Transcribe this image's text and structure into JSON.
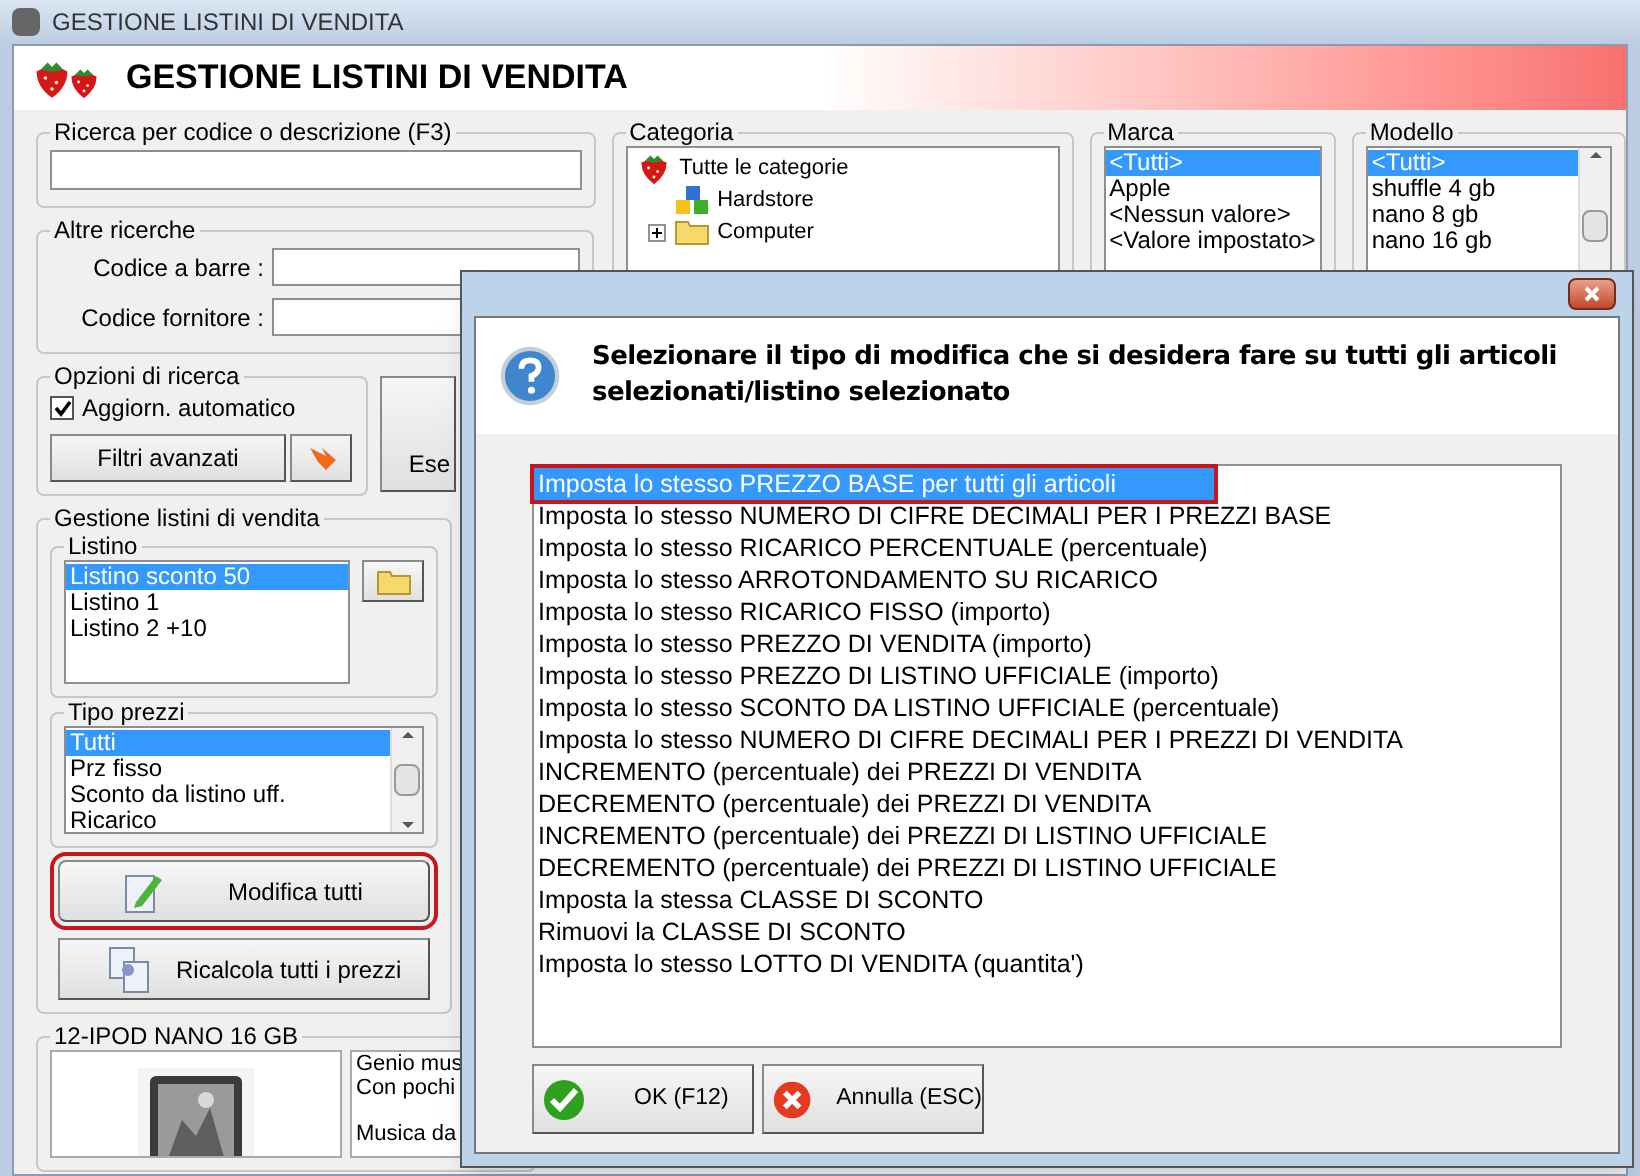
{
  "window": {
    "title": "GESTIONE LISTINI DI VENDITA"
  },
  "header": {
    "title": "GESTIONE LISTINI DI VENDITA"
  },
  "search": {
    "label": "Ricerca per codice o descrizione (F3)"
  },
  "other_searches": {
    "label": "Altre ricerche",
    "fields": [
      {
        "label": "Codice a barre :"
      },
      {
        "label": "Codice fornitore :"
      }
    ]
  },
  "search_options": {
    "label": "Opzioni di ricerca",
    "auto_update": {
      "label": "Aggiorn. automatico",
      "checked": true
    },
    "filters_button": "Filtri avanzati"
  },
  "execute_button": "Ese",
  "price_lists": {
    "label": "Gestione listini di vendita",
    "listino": {
      "label": "Listino",
      "items": [
        {
          "label": "Listino sconto 50",
          "selected": true
        },
        {
          "label": "Listino 1",
          "selected": false
        },
        {
          "label": "Listino 2 +10",
          "selected": false
        }
      ]
    },
    "price_types": {
      "label": "Tipo prezzi",
      "items": [
        {
          "label": "Tutti",
          "selected": true
        },
        {
          "label": "Prz fisso",
          "selected": false
        },
        {
          "label": "Sconto da listino uff.",
          "selected": false
        },
        {
          "label": "Ricarico",
          "selected": false
        }
      ]
    },
    "edit_all_button": {
      "label": "Modifica tutti",
      "highlighted": true
    },
    "recalc_button": {
      "label": "Ricalcola tutti i prezzi",
      "highlighted": false
    }
  },
  "product": {
    "title": "12-IPOD NANO 16 GB",
    "description_paragraphs": [
      [
        "Genio mus",
        "Con pochi"
      ],
      [
        "Musica da"
      ]
    ]
  },
  "categoria": {
    "label": "Categoria",
    "tree": [
      {
        "label": "Tutte le categorie",
        "kind": "root",
        "children": [
          {
            "label": "Hardstore",
            "kind": "store"
          },
          {
            "label": "Computer",
            "kind": "folder",
            "expanded": false
          }
        ]
      }
    ]
  },
  "marca": {
    "label": "Marca",
    "items": [
      {
        "label": "<Tutti>",
        "selected": true
      },
      {
        "label": "Apple",
        "selected": false
      },
      {
        "label": "<Nessun valore>",
        "selected": false
      },
      {
        "label": "<Valore impostato>",
        "selected": false
      }
    ]
  },
  "modello": {
    "label": "Modello",
    "items": [
      {
        "label": "<Tutti>",
        "selected": true
      },
      {
        "label": "shuffle 4 gb",
        "selected": false
      },
      {
        "label": "nano 8 gb",
        "selected": false
      },
      {
        "label": "nano 16 gb",
        "selected": false
      }
    ]
  },
  "dialog": {
    "message": "Selezionare il tipo di modifica che si desidera fare su tutti gli articoli selezionati/listino selezionato",
    "options": [
      {
        "label": "Imposta lo stesso PREZZO BASE per tutti gli articoli",
        "selected": true,
        "highlighted": true
      },
      {
        "label": "Imposta lo stesso NUMERO DI CIFRE DECIMALI PER I PREZZI BASE",
        "selected": false,
        "highlighted": false
      },
      {
        "label": "Imposta lo stesso RICARICO PERCENTUALE (percentuale)",
        "selected": false,
        "highlighted": false
      },
      {
        "label": "Imposta lo stesso ARROTONDAMENTO SU RICARICO",
        "selected": false,
        "highlighted": false
      },
      {
        "label": "Imposta lo stesso RICARICO FISSO (importo)",
        "selected": false,
        "highlighted": false
      },
      {
        "label": "Imposta lo stesso PREZZO DI VENDITA (importo)",
        "selected": false,
        "highlighted": false
      },
      {
        "label": "Imposta lo stesso PREZZO DI LISTINO UFFICIALE (importo)",
        "selected": false,
        "highlighted": false
      },
      {
        "label": "Imposta lo stesso SCONTO DA LISTINO UFFICIALE (percentuale)",
        "selected": false,
        "highlighted": false
      },
      {
        "label": "Imposta lo stesso NUMERO DI CIFRE DECIMALI PER I PREZZI DI VENDITA",
        "selected": false,
        "highlighted": false
      },
      {
        "label": "INCREMENTO (percentuale) dei PREZZI DI VENDITA",
        "selected": false,
        "highlighted": false
      },
      {
        "label": "DECREMENTO (percentuale) dei PREZZI DI VENDITA",
        "selected": false,
        "highlighted": false
      },
      {
        "label": "INCREMENTO (percentuale) dei PREZZI DI LISTINO UFFICIALE",
        "selected": false,
        "highlighted": false
      },
      {
        "label": "DECREMENTO (percentuale) dei PREZZI DI LISTINO UFFICIALE",
        "selected": false,
        "highlighted": false
      },
      {
        "label": "Imposta la stessa CLASSE DI SCONTO",
        "selected": false,
        "highlighted": false
      },
      {
        "label": "Rimuovi la CLASSE DI SCONTO",
        "selected": false,
        "highlighted": false
      },
      {
        "label": "Imposta lo stesso LOTTO DI VENDITA (quantita')",
        "selected": false,
        "highlighted": false
      }
    ],
    "buttons": [
      {
        "label": "OK (F12)",
        "kind": "ok"
      },
      {
        "label": "Annulla (ESC)",
        "kind": "cancel"
      }
    ]
  }
}
